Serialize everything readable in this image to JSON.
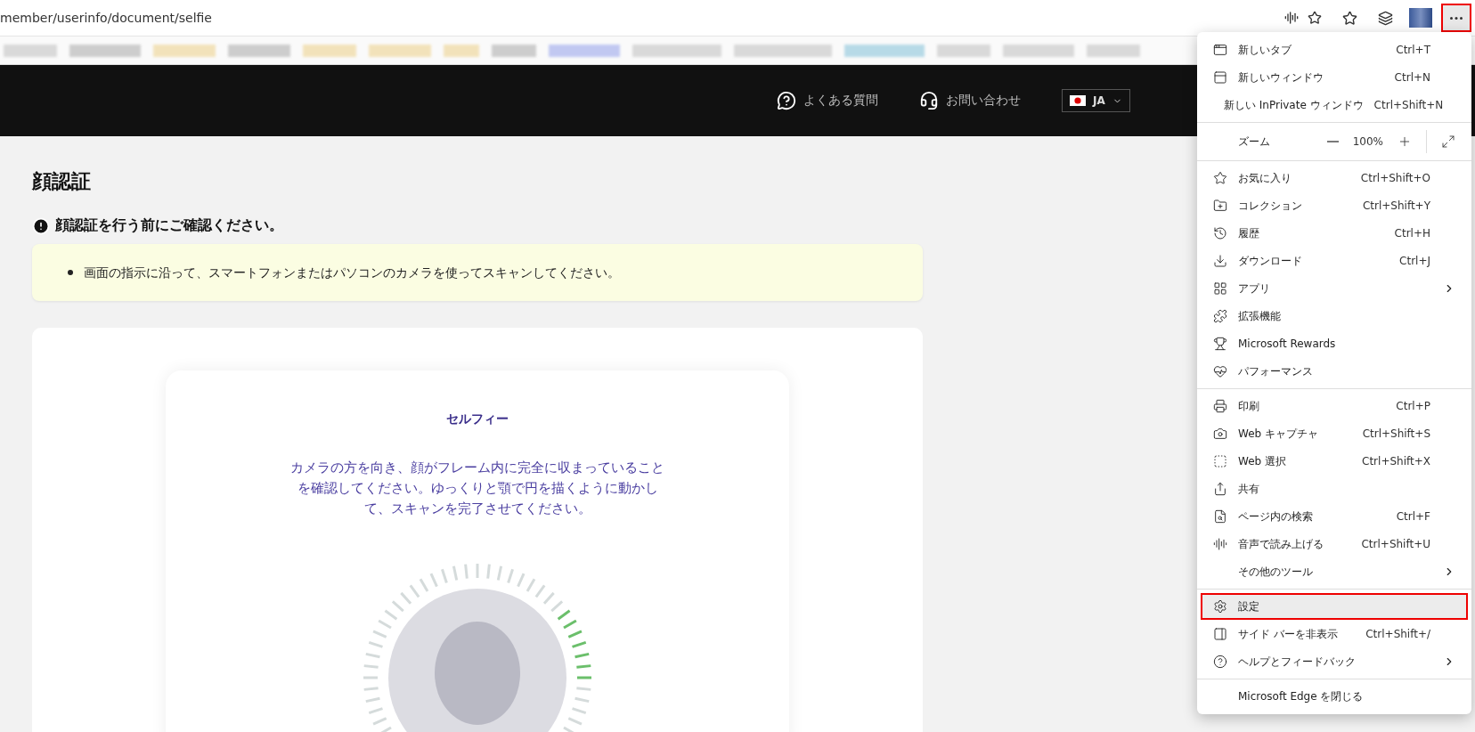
{
  "browser": {
    "url": "member/userinfo/document/selfie",
    "more_button": {
      "active": true
    }
  },
  "header": {
    "links": [
      "よくある質問",
      "お問い合わせ"
    ],
    "language": "JA"
  },
  "page": {
    "title": "顔認証",
    "notice_heading": "顔認証を行う前にご確認ください。",
    "notice_items": [
      "画面の指示に沿って、スマートフォンまたはパソコンのカメラを使ってスキャンしてください。"
    ],
    "selfie": {
      "title": "セルフィー",
      "instructions": "カメラの方を向き、顔がフレーム内に完全に収まっていることを確認してください。ゆっくりと顎で円を描くように動かして、スキャンを完了させてください。",
      "scan": {
        "level": 0.12
      }
    }
  },
  "menu": {
    "items": [
      {
        "kind": "item",
        "label": "新しいタブ",
        "shortcut": "Ctrl+T",
        "submenu": false,
        "selected": false
      },
      {
        "kind": "item",
        "label": "新しいウィンドウ",
        "shortcut": "Ctrl+N",
        "submenu": false,
        "selected": false
      },
      {
        "kind": "item",
        "label": "新しい InPrivate ウィンドウ",
        "shortcut": "Ctrl+Shift+N",
        "submenu": false,
        "selected": false
      },
      {
        "kind": "divider"
      },
      {
        "kind": "zoom",
        "label": "ズーム",
        "value": "100%"
      },
      {
        "kind": "divider"
      },
      {
        "kind": "item",
        "label": "お気に入り",
        "shortcut": "Ctrl+Shift+O",
        "submenu": false,
        "selected": false
      },
      {
        "kind": "item",
        "label": "コレクション",
        "shortcut": "Ctrl+Shift+Y",
        "submenu": false,
        "selected": false
      },
      {
        "kind": "item",
        "label": "履歴",
        "shortcut": "Ctrl+H",
        "submenu": false,
        "selected": false
      },
      {
        "kind": "item",
        "label": "ダウンロード",
        "shortcut": "Ctrl+J",
        "submenu": false,
        "selected": false
      },
      {
        "kind": "item",
        "label": "アプリ",
        "submenu": true,
        "selected": false
      },
      {
        "kind": "item",
        "label": "拡張機能",
        "submenu": false,
        "selected": false
      },
      {
        "kind": "item",
        "label": "Microsoft Rewards",
        "submenu": false,
        "selected": false
      },
      {
        "kind": "item",
        "label": "パフォーマンス",
        "submenu": false,
        "selected": false
      },
      {
        "kind": "divider"
      },
      {
        "kind": "item",
        "label": "印刷",
        "shortcut": "Ctrl+P",
        "submenu": false,
        "selected": false
      },
      {
        "kind": "item",
        "label": "Web キャプチャ",
        "shortcut": "Ctrl+Shift+S",
        "submenu": false,
        "selected": false
      },
      {
        "kind": "item",
        "label": "Web 選択",
        "shortcut": "Ctrl+Shift+X",
        "submenu": false,
        "selected": false
      },
      {
        "kind": "item",
        "label": "共有",
        "submenu": false,
        "selected": false
      },
      {
        "kind": "item",
        "label": "ページ内の検索",
        "shortcut": "Ctrl+F",
        "submenu": false,
        "selected": false
      },
      {
        "kind": "item",
        "label": "音声で読み上げる",
        "shortcut": "Ctrl+Shift+U",
        "submenu": false,
        "selected": false
      },
      {
        "kind": "item",
        "label": "その他のツール",
        "submenu": true,
        "selected": false
      },
      {
        "kind": "divider"
      },
      {
        "kind": "item",
        "label": "設定",
        "submenu": false,
        "selected": true
      },
      {
        "kind": "item",
        "label": "サイド バーを非表示",
        "shortcut": "Ctrl+Shift+/",
        "submenu": false,
        "selected": false
      },
      {
        "kind": "item",
        "label": "ヘルプとフィードバック",
        "submenu": true,
        "selected": false
      },
      {
        "kind": "divider"
      },
      {
        "kind": "item",
        "label": "Microsoft Edge を閉じる",
        "submenu": false,
        "selected": false
      }
    ]
  }
}
